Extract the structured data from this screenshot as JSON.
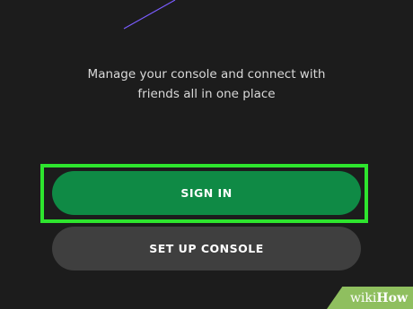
{
  "tagline": {
    "line1": "Manage your console and connect with",
    "line2": "friends all in one place"
  },
  "buttons": {
    "sign_in": "SIGN IN",
    "set_up_console": "SET UP CONSOLE"
  },
  "watermark": {
    "wiki": "wiki",
    "how": "How"
  },
  "colors": {
    "background": "#1c1c1c",
    "sign_in_green": "#0f8a45",
    "setup_grey": "#3f3f3f",
    "highlight": "#2ee52e",
    "watermark_green": "#8fbf5f",
    "deco_line": "#7a5cff"
  }
}
